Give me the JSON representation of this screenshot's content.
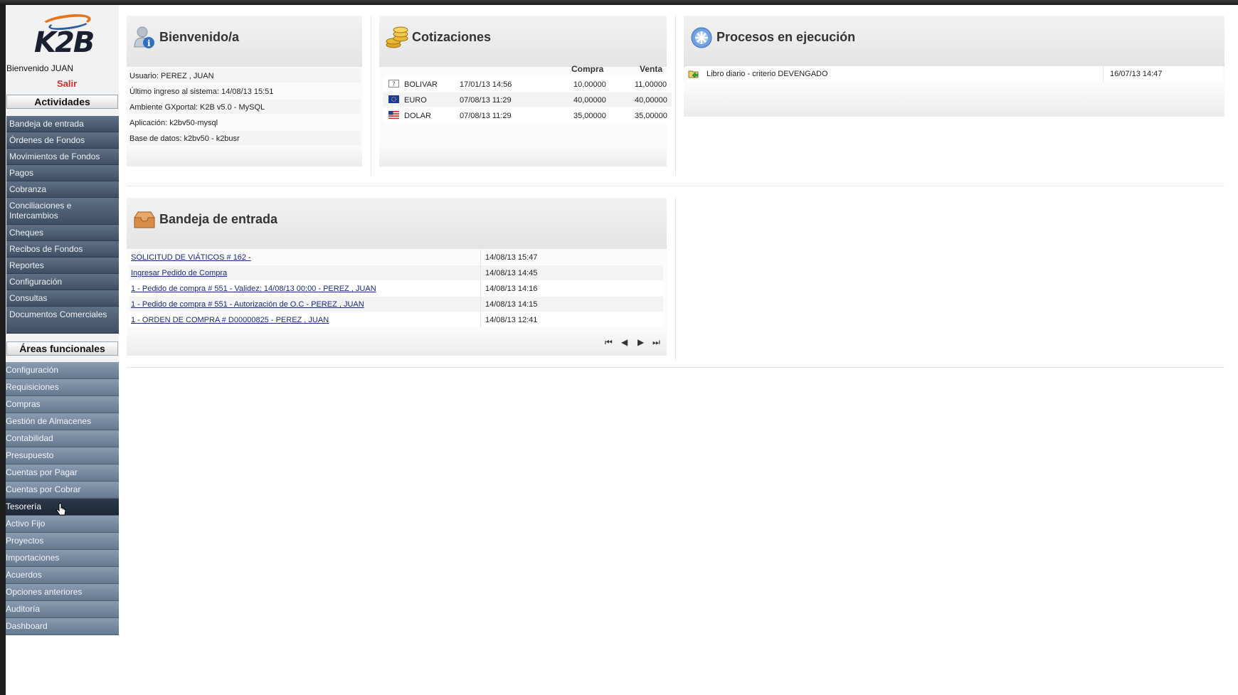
{
  "sidebar": {
    "logo_text": "K2B",
    "welcome": "Bienvenido JUAN",
    "logout": "Salir",
    "actividades_title": "Actividades",
    "actividades": [
      "Bandeja de entrada",
      "Órdenes de Fondos",
      "Movimientos de Fondos",
      "Pagos",
      "Cobranza",
      "Conciliaciones e Intercambios",
      "Cheques",
      "Recibos de Fondos",
      "Reportes",
      "Configuración",
      "Consultas",
      "Documentos Comerciales"
    ],
    "areas_title": "Áreas funcionales",
    "areas": [
      "Configuración",
      "Requisiciones",
      "Compras",
      "Gestión de Almacenes",
      "Contabilidad",
      "Presupuesto",
      "Cuentas por Pagar",
      "Cuentas por Cobrar",
      "Tesorería",
      "Activo Fijo",
      "Proyectos",
      "Importaciones",
      "Acuerdos",
      "Opciones anteriores",
      "Auditoría",
      "Dashboard"
    ],
    "active_area": "Tesorería"
  },
  "welcome_panel": {
    "title": "Bienvenido/a",
    "rows": [
      "Usuario: PEREZ , JUAN",
      "Último ingreso al sistema: 14/08/13 15:51",
      "Ambiente GXportal: K2B v5.0 - MySQL",
      "Aplicación: k2bv50-mysql",
      "Base de datos: k2bv50 - k2busr"
    ]
  },
  "quotes_panel": {
    "title": "Cotizaciones",
    "col_buy": "Compra",
    "col_sell": "Venta",
    "rows": [
      {
        "currency": "BOLIVAR",
        "date": "17/01/13 14:56",
        "buy": "10,00000",
        "sell": "11,00000",
        "flag_icon": "unknown-flag-icon"
      },
      {
        "currency": "EURO",
        "date": "07/08/13 11:29",
        "buy": "40,00000",
        "sell": "40,00000",
        "flag_icon": "eu-flag-icon"
      },
      {
        "currency": "DOLAR",
        "date": "07/08/13 11:29",
        "buy": "35,00000",
        "sell": "35,00000",
        "flag_icon": "us-flag-icon"
      }
    ]
  },
  "process_panel": {
    "title": "Procesos en ejecución",
    "rows": [
      {
        "name": "Libro diario - criterio DEVENGADO",
        "date": "16/07/13 14:47"
      }
    ]
  },
  "inbox_panel": {
    "title": "Bandeja de entrada",
    "rows": [
      {
        "label": "SOLICITUD DE VIÁTICOS # 162 -",
        "date": "14/08/13 15:47"
      },
      {
        "label": "Ingresar Pedido de Compra",
        "date": "14/08/13 14:45"
      },
      {
        "label": "1 - Pedido de compra # 551 - Validez: 14/08/13 00:00 - PEREZ , JUAN",
        "date": "14/08/13 14:16"
      },
      {
        "label": "1 - Pedido de compra # 551 - Autorización de O.C - PEREZ , JUAN",
        "date": "14/08/13 14:15"
      },
      {
        "label": "1 - ORDEN DE COMPRA # D00000825 - PEREZ , JUAN",
        "date": "14/08/13 12:41"
      }
    ],
    "pager": {
      "first": "⏮",
      "prev": "◀",
      "next": "▶",
      "last": "⏭"
    }
  },
  "colors": {
    "sidebar_dark": "#3f4f63",
    "sidebar_light": "#647890",
    "logout_red": "#d03030",
    "link_blue": "#1c2a7a"
  }
}
